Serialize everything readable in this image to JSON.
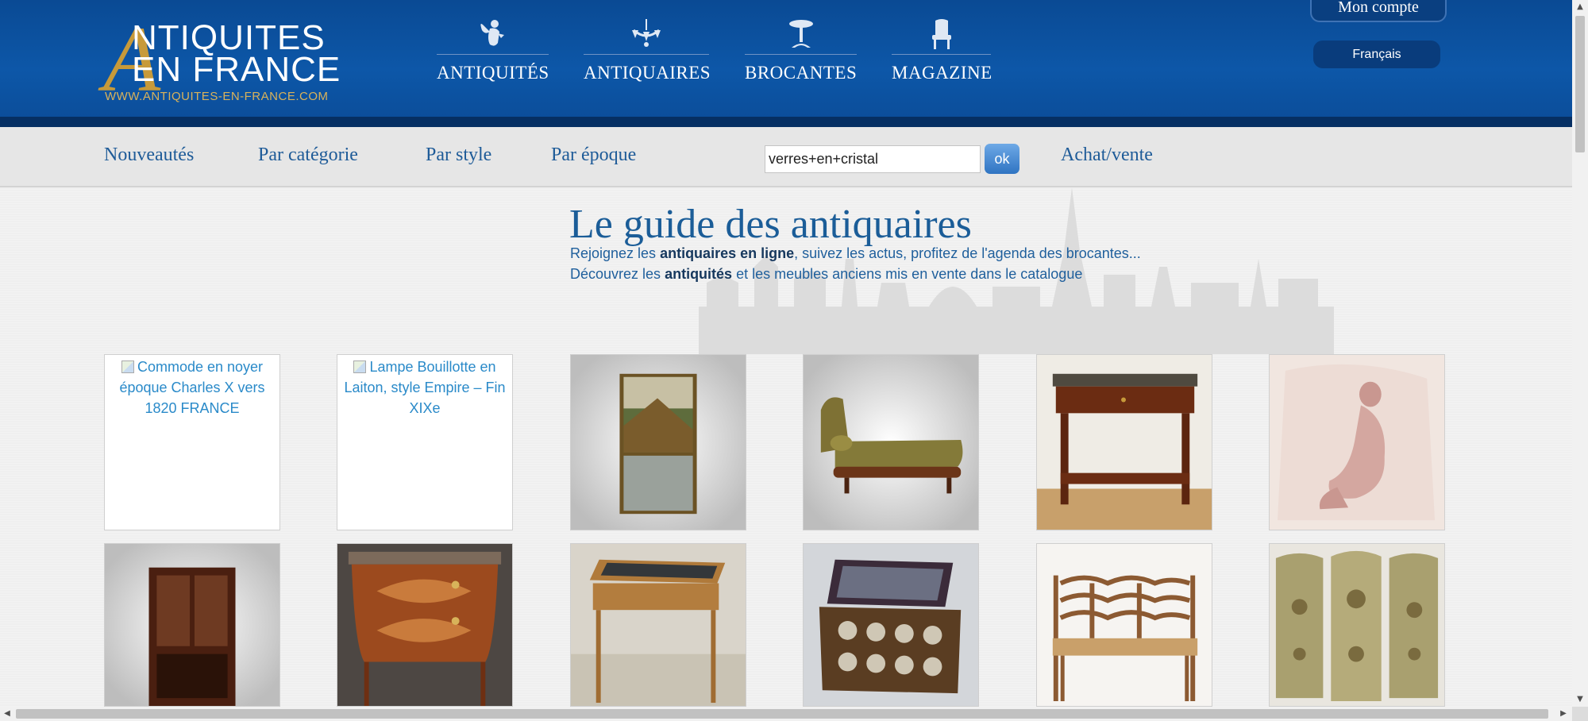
{
  "header": {
    "logo": {
      "letter": "A",
      "line1": "NTIQUITES",
      "line2": "EN FRANCE",
      "url": "WWW.ANTIQUITES-EN-FRANCE.COM"
    },
    "nav": [
      {
        "label": "ANTIQUITÉS",
        "icon": "angel-icon"
      },
      {
        "label": "ANTIQUAIRES",
        "icon": "chandelier-icon"
      },
      {
        "label": "BROCANTES",
        "icon": "pedestal-table-icon"
      },
      {
        "label": "MAGAZINE",
        "icon": "armchair-icon"
      }
    ],
    "account_label": "Mon compte",
    "language_label": "Français"
  },
  "subnav": {
    "links": [
      "Nouveautés",
      "Par catégorie",
      "Par style",
      "Par époque"
    ],
    "search_value": "verres+en+cristal",
    "search_button": "ok",
    "achat_label": "Achat/vente"
  },
  "hero": {
    "title": "Le guide des antiquaires",
    "line1_pre": "Rejoignez les ",
    "line1_bold": "antiquaires en ligne",
    "line1_post": ", suivez les actus, profitez de l'agenda des brocantes...",
    "line2_pre": "Découvrez les ",
    "line2_bold": "antiquités",
    "line2_post": " et les meubles anciens mis en vente dans le catalogue"
  },
  "products": [
    {
      "alt": "Commode en noyer époque Charles X vers 1820 FRANCE",
      "broken": true
    },
    {
      "alt": "Lampe Bouillotte en Laiton, style Empire – Fin XIXe",
      "broken": true
    },
    {
      "subject": "trumeau-mirror-painting"
    },
    {
      "subject": "chaise-longue"
    },
    {
      "subject": "console-table"
    },
    {
      "subject": "nude-painting"
    },
    {
      "subject": "vitrine-cabinet"
    },
    {
      "subject": "marquetry-commode"
    },
    {
      "subject": "writing-desk"
    },
    {
      "subject": "vanity-case"
    },
    {
      "subject": "rush-bench"
    },
    {
      "subject": "folding-screen"
    }
  ],
  "colors": {
    "header_blue": "#0d57a8",
    "link_blue": "#1e5b98",
    "logo_gold": "#c79a3a"
  }
}
